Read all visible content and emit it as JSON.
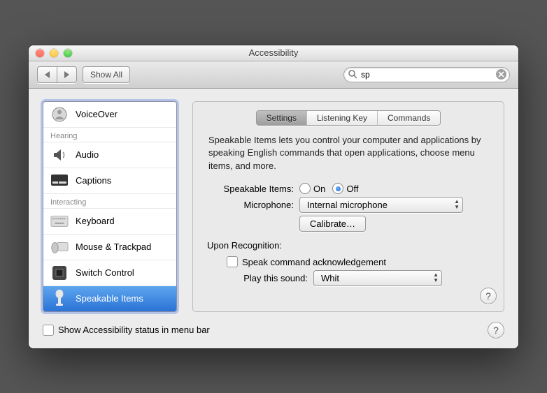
{
  "window": {
    "title": "Accessibility"
  },
  "toolbar": {
    "show_all": "Show All",
    "search_value": "sp"
  },
  "sidebar": {
    "groups": [
      {
        "header": null,
        "items": [
          {
            "id": "voiceover",
            "label": "VoiceOver"
          }
        ]
      },
      {
        "header": "Hearing",
        "items": [
          {
            "id": "audio",
            "label": "Audio"
          },
          {
            "id": "captions",
            "label": "Captions"
          }
        ]
      },
      {
        "header": "Interacting",
        "items": [
          {
            "id": "keyboard",
            "label": "Keyboard"
          },
          {
            "id": "mouse-trackpad",
            "label": "Mouse & Trackpad"
          },
          {
            "id": "switch-control",
            "label": "Switch Control"
          },
          {
            "id": "speakable-items",
            "label": "Speakable Items"
          }
        ]
      }
    ],
    "selected_id": "speakable-items"
  },
  "panel": {
    "tabs": {
      "settings": "Settings",
      "listening_key": "Listening Key",
      "commands": "Commands",
      "active": "settings"
    },
    "description": "Speakable Items lets you control your computer and applications by speaking English commands that open applications, choose menu items, and more.",
    "speakable_items": {
      "label": "Speakable Items:",
      "on": "On",
      "off": "Off",
      "value": "off"
    },
    "microphone": {
      "label": "Microphone:",
      "selected": "Internal microphone",
      "calibrate": "Calibrate…"
    },
    "recognition": {
      "header": "Upon Recognition:",
      "speak_ack": {
        "label": "Speak command acknowledgement",
        "checked": false
      },
      "play_sound": {
        "label": "Play this sound:",
        "selected": "Whit"
      }
    }
  },
  "footer": {
    "menubar_status": {
      "label": "Show Accessibility status in menu bar",
      "checked": false
    }
  },
  "help_glyph": "?"
}
